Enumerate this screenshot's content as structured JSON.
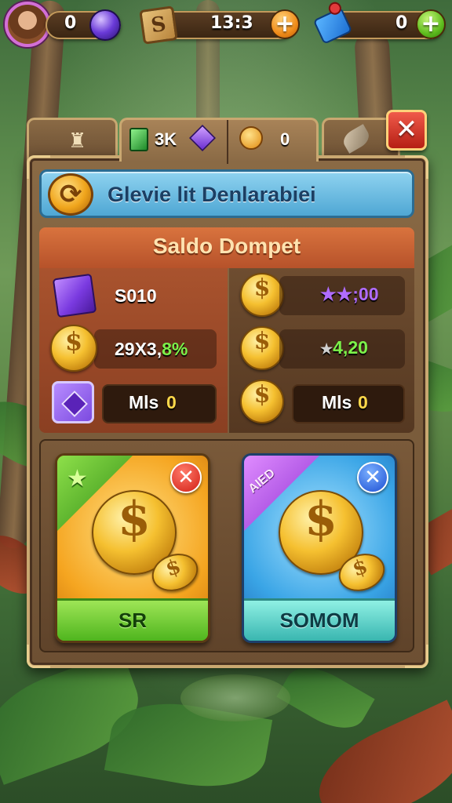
{
  "hud": {
    "player_gems": "0",
    "crates_value": "13:3",
    "tickets_value": "0"
  },
  "tabs": [
    {
      "icon": "character-icon",
      "label": ""
    },
    {
      "icon": "gem-icon",
      "label": "3K"
    },
    {
      "icon": "medal-icon",
      "label": "0"
    },
    {
      "icon": "feather-icon",
      "label": ""
    }
  ],
  "title": {
    "text": "Glevie lit Denlarabiei"
  },
  "balance": {
    "header": "Saldo Dompet",
    "left": [
      {
        "icon": "purple-cube-icon",
        "value": "S010"
      },
      {
        "icon": "coin-icon",
        "value_white": "29X3,",
        "value_green": "8%"
      },
      {
        "icon": "purple-chest-icon",
        "label": "Mls",
        "value": "0"
      }
    ],
    "right": [
      {
        "icon": "coin-icon",
        "stars": "★★",
        "value": ";00"
      },
      {
        "icon": "coin-icon",
        "stars": "★",
        "value": "4,20"
      },
      {
        "icon": "coin-icon",
        "label": "Mls",
        "value": "0"
      }
    ]
  },
  "offers": [
    {
      "variant": "gold",
      "ribbon": "",
      "button": "SR",
      "close": "✕"
    },
    {
      "variant": "blue",
      "ribbon": "AIED",
      "button": "SOMOM",
      "close": "✕"
    }
  ],
  "close_button": "✕",
  "colors": {
    "accent_gold": "#f5c030",
    "title_blue": "#4fa7d4",
    "balance_orange": "#d9733e",
    "value_yellow": "#ffd84a",
    "value_green": "#7cf24a",
    "star_purple": "#b06cff"
  }
}
